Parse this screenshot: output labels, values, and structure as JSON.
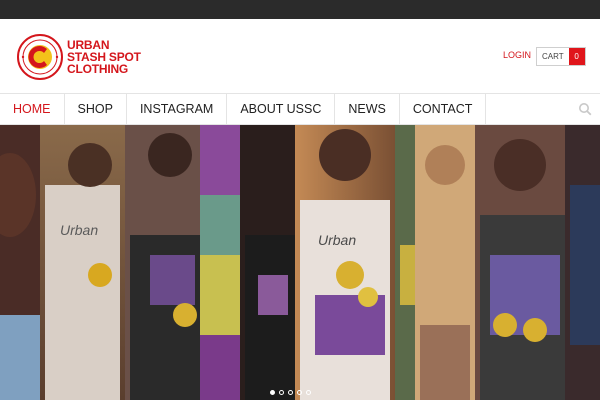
{
  "brand": {
    "name_lines": [
      "URBAN",
      "STASH SPOT",
      "CLOTHING"
    ],
    "accent_color": "#d4161c",
    "badge_icon": "ussc-logo-badge"
  },
  "header": {
    "login_label": "LOGIN",
    "cart_label": "CART",
    "cart_count": "0"
  },
  "nav": {
    "items": [
      {
        "label": "HOME",
        "active": true
      },
      {
        "label": "SHOP",
        "active": false
      },
      {
        "label": "INSTAGRAM",
        "active": false
      },
      {
        "label": "ABOUT USSC",
        "active": false
      },
      {
        "label": "NEWS",
        "active": false
      },
      {
        "label": "CONTACT",
        "active": false
      }
    ],
    "search_icon": "search-icon"
  },
  "slider": {
    "slide_count": 5,
    "active_index": 0
  }
}
